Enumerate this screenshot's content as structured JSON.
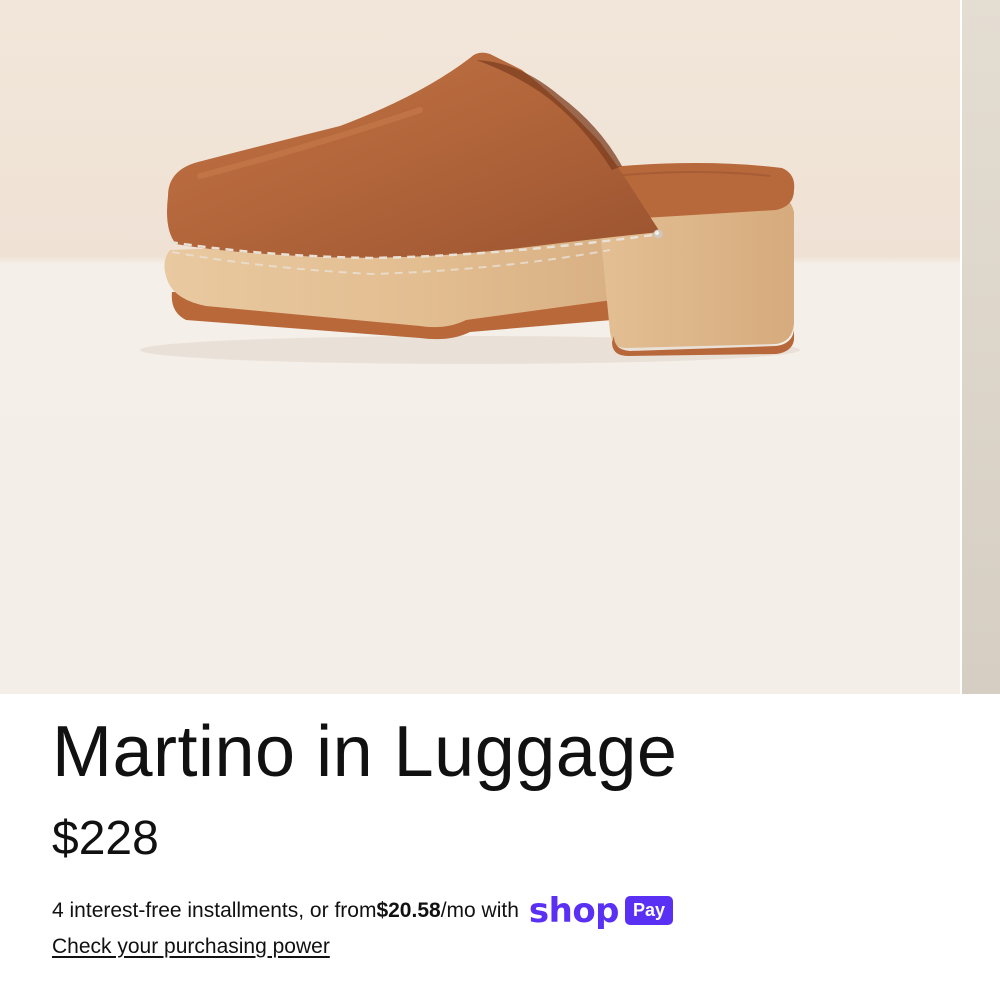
{
  "product": {
    "title": "Martino in Luggage",
    "price": "$228"
  },
  "installments": {
    "prefix": "4 interest-free installments, or from ",
    "amount": "$20.58",
    "suffix": "/mo with ",
    "shop_logo_text": "shop",
    "pay_badge_text": "Pay"
  },
  "purchasing_link": "Check your purchasing power",
  "colors": {
    "shop_pay_brand": "#5a31f4",
    "leather": "#b86a3c",
    "wood": "#e6c49a"
  },
  "icons": {
    "product_image": "clog-shoe-photo"
  }
}
